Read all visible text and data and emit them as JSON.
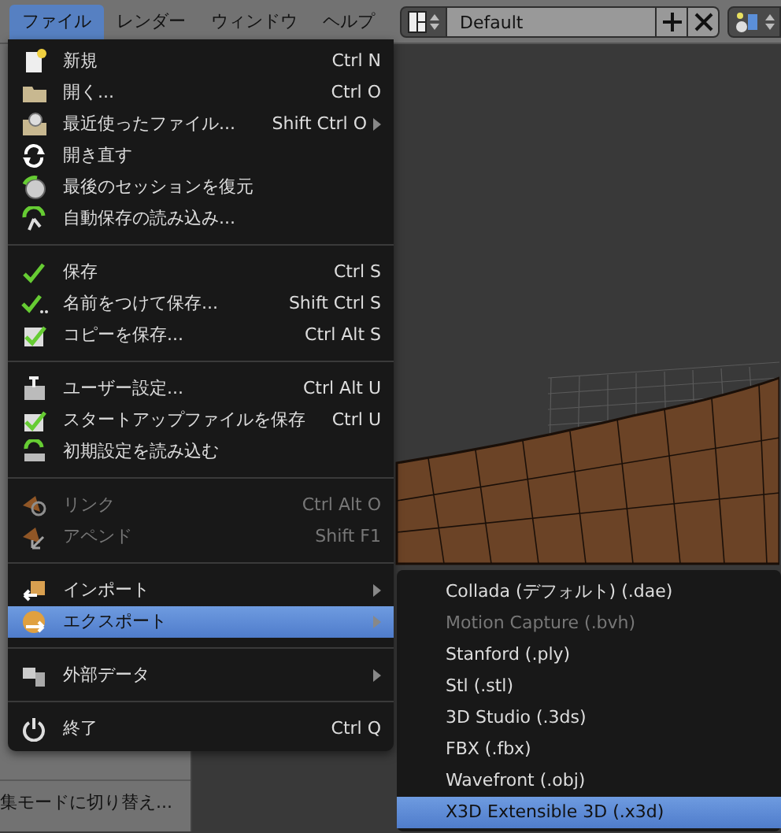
{
  "menubar": [
    {
      "label": "ファイル",
      "selected": true
    },
    {
      "label": "レンダー",
      "selected": false
    },
    {
      "label": "ウィンドウ",
      "selected": false
    },
    {
      "label": "ヘルプ",
      "selected": false
    }
  ],
  "layout_selector": {
    "value": "Default"
  },
  "file_menu": {
    "groups": [
      {
        "items": [
          {
            "label": "新規",
            "shortcut": "Ctrl N",
            "disabled": false,
            "has_submenu": false,
            "selected": false
          },
          {
            "label": "開く...",
            "shortcut": "Ctrl O",
            "disabled": false,
            "has_submenu": false,
            "selected": false
          },
          {
            "label": "最近使ったファイル...",
            "shortcut": "Shift Ctrl O",
            "disabled": false,
            "has_submenu": true,
            "selected": false
          },
          {
            "label": "開き直す",
            "disabled": false,
            "has_submenu": false,
            "selected": false
          },
          {
            "label": "最後のセッションを復元",
            "disabled": false,
            "has_submenu": false,
            "selected": false
          },
          {
            "label": "自動保存の読み込み...",
            "disabled": false,
            "has_submenu": false,
            "selected": false
          }
        ]
      },
      {
        "items": [
          {
            "label": "保存",
            "shortcut": "Ctrl S",
            "disabled": false,
            "has_submenu": false,
            "selected": false
          },
          {
            "label": "名前をつけて保存...",
            "shortcut": "Shift Ctrl S",
            "disabled": false,
            "has_submenu": false,
            "selected": false
          },
          {
            "label": "コピーを保存...",
            "shortcut": "Ctrl Alt S",
            "disabled": false,
            "has_submenu": false,
            "selected": false
          }
        ]
      },
      {
        "items": [
          {
            "label": "ユーザー設定...",
            "shortcut": "Ctrl Alt U",
            "disabled": false,
            "has_submenu": false,
            "selected": false
          },
          {
            "label": "スタートアップファイルを保存",
            "shortcut": "Ctrl U",
            "disabled": false,
            "has_submenu": false,
            "selected": false
          },
          {
            "label": "初期設定を読み込む",
            "disabled": false,
            "has_submenu": false,
            "selected": false
          }
        ]
      },
      {
        "items": [
          {
            "label": "リンク",
            "shortcut": "Ctrl Alt O",
            "disabled": true,
            "has_submenu": false,
            "selected": false
          },
          {
            "label": "アペンド",
            "shortcut": "Shift F1",
            "disabled": true,
            "has_submenu": false,
            "selected": false
          }
        ]
      },
      {
        "items": [
          {
            "label": "インポート",
            "disabled": false,
            "has_submenu": true,
            "selected": false
          },
          {
            "label": "エクスポート",
            "disabled": false,
            "has_submenu": true,
            "selected": true
          }
        ]
      },
      {
        "items": [
          {
            "label": "外部データ",
            "disabled": false,
            "has_submenu": true,
            "selected": false
          }
        ]
      },
      {
        "items": [
          {
            "label": "終了",
            "shortcut": "Ctrl Q",
            "disabled": false,
            "has_submenu": false,
            "selected": false
          }
        ]
      }
    ]
  },
  "export_submenu": [
    {
      "label": "Collada (デフォルト) (.dae)",
      "disabled": false,
      "selected": false
    },
    {
      "label": "Motion Capture (.bvh)",
      "disabled": true,
      "selected": false
    },
    {
      "label": "Stanford (.ply)",
      "disabled": false,
      "selected": false
    },
    {
      "label": "Stl (.stl)",
      "disabled": false,
      "selected": false
    },
    {
      "label": "3D Studio (.3ds)",
      "disabled": false,
      "selected": false
    },
    {
      "label": "FBX (.fbx)",
      "disabled": false,
      "selected": false
    },
    {
      "label": "Wavefront (.obj)",
      "disabled": false,
      "selected": false
    },
    {
      "label": "X3D Extensible 3D (.x3d)",
      "disabled": false,
      "selected": true
    }
  ],
  "tool_panel": {
    "footer_text": "集モードに切り替え..."
  }
}
